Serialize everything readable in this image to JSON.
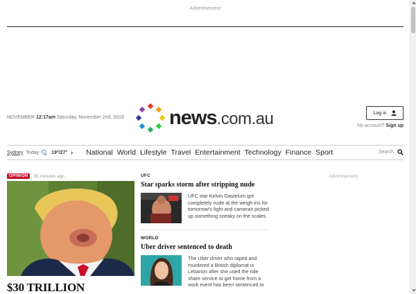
{
  "ads": {
    "top_label": "Advertisement",
    "right_label": "Advertisement"
  },
  "masthead": {
    "month": "NOVEMBER",
    "time": "12:17am",
    "date": "Saturday, November 2nd, 2019",
    "logo_news": "news",
    "logo_domain": ".com.au",
    "login_label": "Log in",
    "no_account": "No account?",
    "signup_label": "Sign up"
  },
  "weather": {
    "city": "Sydney",
    "day": "Today",
    "temps": "19°/27°",
    "icon": "partly-sunny-icon"
  },
  "nav": {
    "items": [
      "National",
      "World",
      "Lifestyle",
      "Travel",
      "Entertainment",
      "Technology",
      "Finance",
      "Sport"
    ],
    "search_label": "Search"
  },
  "lead": {
    "badge": "OPINION",
    "time_ago": "35 minutes ago",
    "headline": "$30 TRILLION"
  },
  "stories": [
    {
      "section": "UFC",
      "title": "Star sparks storm after stripping nude",
      "summary": "UFC star Kelvin Gastelum got completely nude at the weigh-ins for tomorrow's fight and cameras picked up something sneaky on the scales."
    },
    {
      "section": "WORLD",
      "title": "Uber driver sentenced to death",
      "summary": "The Uber driver who raped and murdered a British diplomat in Lebanon after she used the ride share service to get home from a work event has been sentenced to"
    }
  ],
  "colors": {
    "opinion_red": "#c8102e",
    "logo_text": "#222222"
  }
}
